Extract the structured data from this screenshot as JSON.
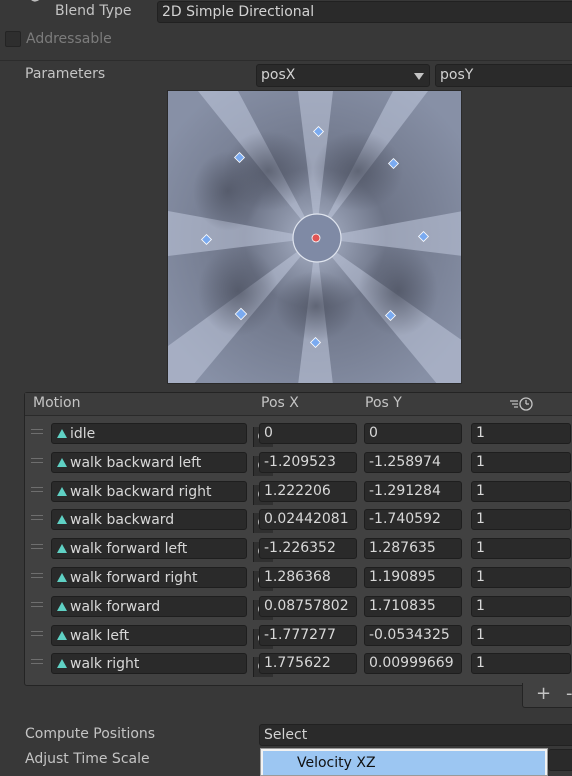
{
  "blend_type": {
    "label": "Blend Type",
    "value": "2D Simple Directional"
  },
  "addressable": {
    "label": "Addressable",
    "checked": false
  },
  "parameters": {
    "label": "Parameters",
    "x_param": "posX",
    "y_param": "posY"
  },
  "motion_table": {
    "headers": {
      "motion": "Motion",
      "pos_x": "Pos X",
      "pos_y": "Pos Y",
      "speed_icon": "speed-clock-icon"
    },
    "rows": [
      {
        "name": "idle",
        "pos_x": "0",
        "pos_y": "0",
        "speed": "1"
      },
      {
        "name": "walk backward left",
        "pos_x": "-1.209523",
        "pos_y": "-1.258974",
        "speed": "1"
      },
      {
        "name": "walk backward right",
        "pos_x": "1.222206",
        "pos_y": "-1.291284",
        "speed": "1"
      },
      {
        "name": "walk backward",
        "pos_x": "0.02442081",
        "pos_y": "-1.740592",
        "speed": "1"
      },
      {
        "name": "walk forward left",
        "pos_x": "-1.226352",
        "pos_y": "1.287635",
        "speed": "1"
      },
      {
        "name": "walk forward right",
        "pos_x": "1.286368",
        "pos_y": "1.190895",
        "speed": "1"
      },
      {
        "name": "walk forward",
        "pos_x": "0.08757802",
        "pos_y": "1.710835",
        "speed": "1"
      },
      {
        "name": "walk left",
        "pos_x": "-1.777277",
        "pos_y": "-0.0534325",
        "speed": "1"
      },
      {
        "name": "walk right",
        "pos_x": "1.775622",
        "pos_y": "0.00999669",
        "speed": "1"
      }
    ],
    "add_label": "+",
    "remove_label": "-"
  },
  "compute_positions": {
    "label": "Compute Positions",
    "value": "Select"
  },
  "adjust_time_scale": {
    "label": "Adjust Time Scale"
  },
  "dropdown": {
    "option": "Velocity XZ"
  },
  "colors": {
    "background": "#383838",
    "field": "#2a2a2a",
    "motion_point": "#7aaaf0",
    "current_point": "#e05555",
    "clip_icon": "#5fd1c4"
  }
}
